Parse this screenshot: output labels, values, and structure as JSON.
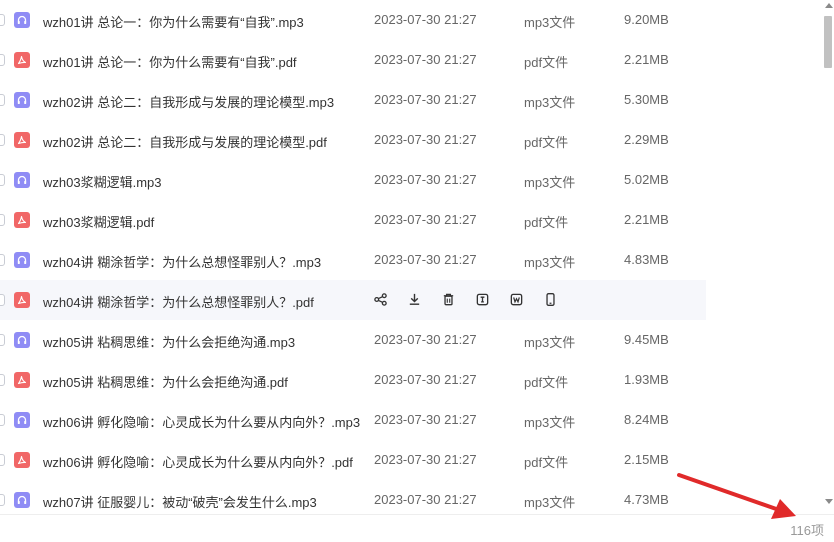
{
  "files": [
    {
      "name": "wzh01讲 总论一：你为什么需要有“自我”.mp3",
      "date": "2023-07-30 21:27",
      "type": "mp3文件",
      "size": "9.20MB",
      "kind": "mp3"
    },
    {
      "name": "wzh01讲 总论一：你为什么需要有“自我”.pdf",
      "date": "2023-07-30 21:27",
      "type": "pdf文件",
      "size": "2.21MB",
      "kind": "pdf"
    },
    {
      "name": "wzh02讲 总论二：自我形成与发展的理论模型.mp3",
      "date": "2023-07-30 21:27",
      "type": "mp3文件",
      "size": "5.30MB",
      "kind": "mp3"
    },
    {
      "name": "wzh02讲 总论二：自我形成与发展的理论模型.pdf",
      "date": "2023-07-30 21:27",
      "type": "pdf文件",
      "size": "2.29MB",
      "kind": "pdf"
    },
    {
      "name": "wzh03浆糊逻辑.mp3",
      "date": "2023-07-30 21:27",
      "type": "mp3文件",
      "size": "5.02MB",
      "kind": "mp3"
    },
    {
      "name": "wzh03浆糊逻辑.pdf",
      "date": "2023-07-30 21:27",
      "type": "pdf文件",
      "size": "2.21MB",
      "kind": "pdf"
    },
    {
      "name": "wzh04讲 糊涂哲学：为什么总想怪罪别人？.mp3",
      "date": "2023-07-30 21:27",
      "type": "mp3文件",
      "size": "4.83MB",
      "kind": "mp3"
    },
    {
      "name": "wzh04讲 糊涂哲学：为什么总想怪罪别人？.pdf",
      "date": "",
      "type": "",
      "size": "",
      "kind": "pdf",
      "hovered": true
    },
    {
      "name": "wzh05讲 粘稠思维：为什么会拒绝沟通.mp3",
      "date": "2023-07-30 21:27",
      "type": "mp3文件",
      "size": "9.45MB",
      "kind": "mp3"
    },
    {
      "name": "wzh05讲 粘稠思维：为什么会拒绝沟通.pdf",
      "date": "2023-07-30 21:27",
      "type": "pdf文件",
      "size": "1.93MB",
      "kind": "pdf"
    },
    {
      "name": "wzh06讲 孵化隐喻：心灵成长为什么要从内向外？.mp3",
      "date": "2023-07-30 21:27",
      "type": "mp3文件",
      "size": "8.24MB",
      "kind": "mp3"
    },
    {
      "name": "wzh06讲 孵化隐喻：心灵成长为什么要从内向外？.pdf",
      "date": "2023-07-30 21:27",
      "type": "pdf文件",
      "size": "2.15MB",
      "kind": "pdf"
    },
    {
      "name": "wzh07讲 征服婴儿：被动“破壳”会发生什么.mp3",
      "date": "2023-07-30 21:27",
      "type": "mp3文件",
      "size": "4.73MB",
      "kind": "mp3"
    }
  ],
  "row_actions": [
    "share-icon",
    "download-icon",
    "delete-icon",
    "rename-icon",
    "word-doc-icon",
    "mobile-icon"
  ],
  "footer": {
    "count": "116项"
  },
  "colors": {
    "mp3_icon": "#8f8cf5",
    "pdf_icon": "#f16767",
    "annotation_arrow": "#e02a2a",
    "hover_row": "#f6f7fb"
  }
}
